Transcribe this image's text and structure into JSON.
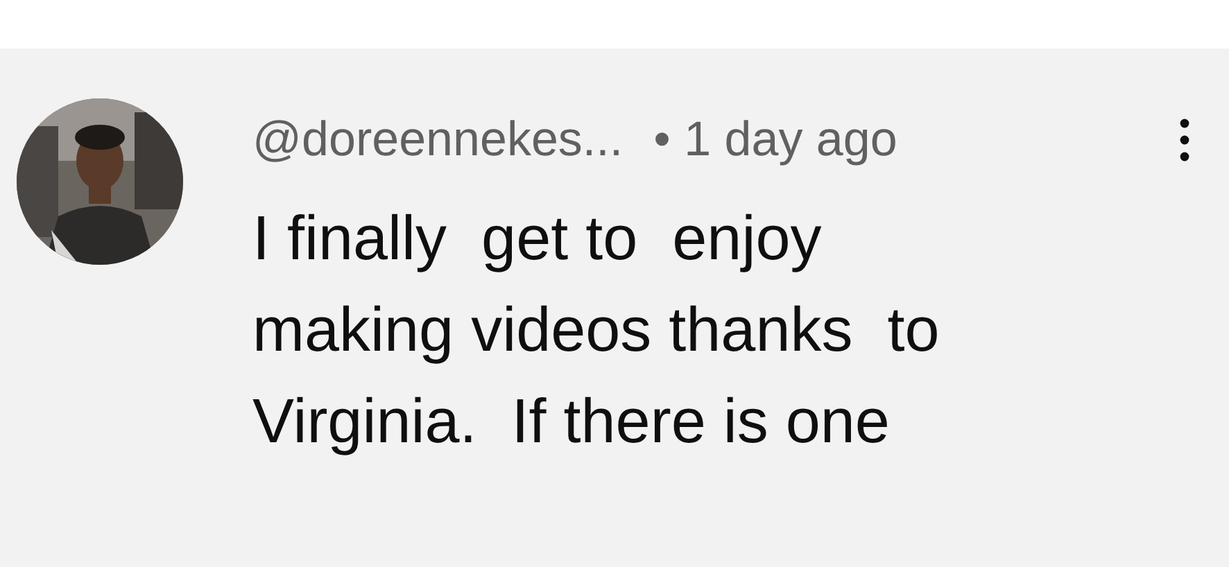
{
  "comment": {
    "author": "@doreennekes...",
    "time": "• 1 day ago",
    "lines": [
      "I finally  get to  enjoy",
      "making videos thanks  to",
      "Virginia.  If there is one"
    ]
  }
}
